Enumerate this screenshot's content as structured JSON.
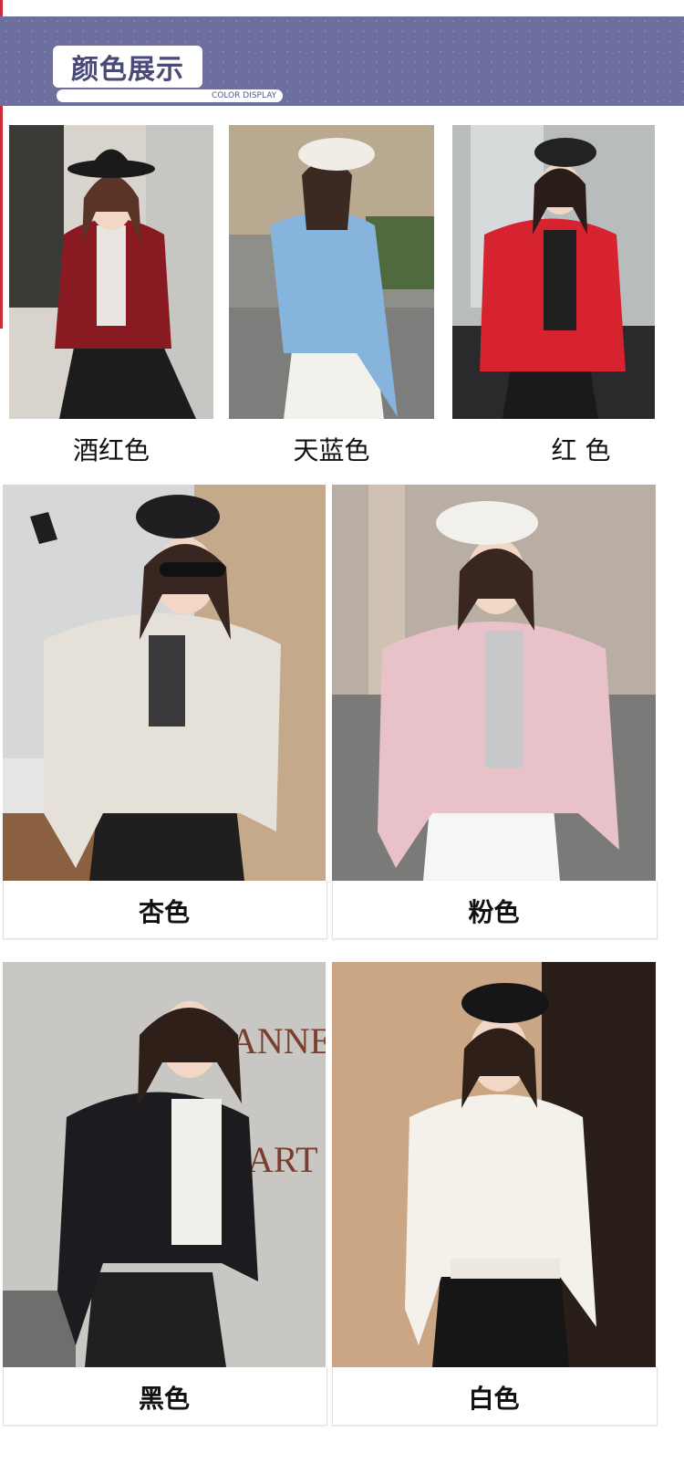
{
  "header": {
    "title": "颜色展示",
    "subtitle": "COLOR DISPLAY"
  },
  "colors": [
    {
      "name": "酒红色",
      "jacket": "#8a1a22",
      "bg": "#d8d3cc",
      "bottom": "#1c1c1c",
      "hat": "#1a1a1a"
    },
    {
      "name": "天蓝色",
      "jacket": "#86b4dd",
      "bg": "#8e8f8a",
      "bottom": "#f2f1ec",
      "hat": "#f0ece6"
    },
    {
      "name": "红 色",
      "jacket": "#d6232f",
      "bg": "#b9bcbc",
      "bottom": "#1a1a1a",
      "hat": "#222222"
    },
    {
      "name": "杏色",
      "jacket": "#e6e1d8",
      "bg": "#c4a98b",
      "bottom": "#1f1f1f",
      "hat": "#1f1f22"
    },
    {
      "name": "粉色",
      "jacket": "#e9c2c9",
      "bg": "#9a9590",
      "bottom": "#f6f6f6",
      "hat": "#f2f0ec"
    },
    {
      "name": "黑色",
      "jacket": "#1c1c20",
      "bg": "#c9c7c3",
      "bottom": "#202020",
      "hat": ""
    },
    {
      "name": "白色",
      "jacket": "#f4f1ea",
      "bg": "#caa684",
      "bottom": "#161616",
      "hat": "#161618"
    }
  ],
  "wall_text": [
    "ANNE",
    "ART"
  ]
}
